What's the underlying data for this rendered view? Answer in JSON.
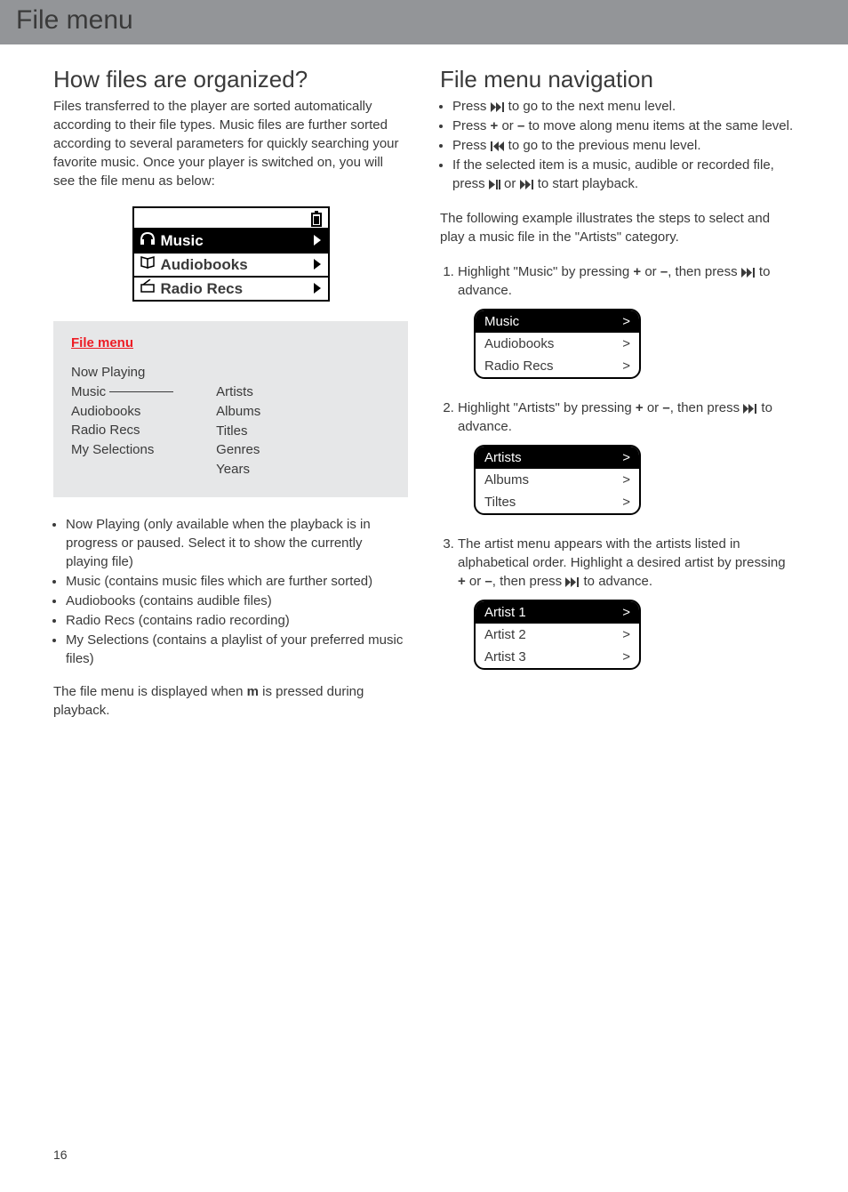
{
  "header": {
    "title": "File menu"
  },
  "page_number": "16",
  "left": {
    "heading": "How files are organized?",
    "intro": "Files transferred to the player are sorted automatically according to their file types. Music files are further sorted according to several parameters for quickly searching your favorite music. Once your player is switched on, you will see the file menu as below:",
    "device_menu": {
      "rows": [
        "Music",
        "Audiobooks",
        "Radio Recs"
      ]
    },
    "info_box": {
      "title": "File menu",
      "col1": [
        "Now Playing",
        "Music",
        "Audiobooks",
        "Radio Recs",
        "My Selections"
      ],
      "col2": [
        "Artists",
        "Albums",
        "Titles",
        "Genres",
        "Years"
      ]
    },
    "bullets": [
      "Now Playing (only available when the playback is in progress or paused. Select it to show the currently playing file)",
      "Music (contains music files which are further sorted)",
      "Audiobooks (contains audible files)",
      "Radio Recs (contains radio recording)",
      "My Selections (contains a playlist of your preferred music files)"
    ],
    "footer_pre": "The file menu is displayed when ",
    "footer_bold": "m",
    "footer_post": " is pressed during playback."
  },
  "right": {
    "heading": "File menu navigation",
    "nav_bullets": {
      "b1_pre": "Press ",
      "b1_post": " to go to the next menu level.",
      "b2_pre": "Press ",
      "b2_plus": "+",
      "b2_mid": " or ",
      "b2_minus": "–",
      "b2_post": " to move along menu items at the same level.",
      "b3_pre": "Press ",
      "b3_post": " to go to the previous menu level.",
      "b4_pre": "If the selected item is a music, audible or recorded file, press ",
      "b4_mid": " or ",
      "b4_post": " to start playback."
    },
    "example_intro": "The following example illustrates the steps to select and play a music file in the \"Artists\" category.",
    "steps": {
      "s1_pre": "Highlight \"Music\" by pressing ",
      "s1_plus": "+",
      "s1_mid": " or ",
      "s1_minus": "–",
      "s1_then": ", then press ",
      "s1_post": " to advance.",
      "screen1": {
        "rows": [
          {
            "label": "Music",
            "arrow": ">",
            "sel": true
          },
          {
            "label": "Audiobooks",
            "arrow": ">",
            "sel": false
          },
          {
            "label": "Radio Recs",
            "arrow": ">",
            "sel": false
          }
        ]
      },
      "s2_pre": "Highlight \"Artists\" by pressing ",
      "s2_plus": "+",
      "s2_mid": " or ",
      "s2_minus": "–",
      "s2_then": ", then press ",
      "s2_post": " to advance.",
      "screen2": {
        "rows": [
          {
            "label": "Artists",
            "arrow": ">",
            "sel": true
          },
          {
            "label": "Albums",
            "arrow": ">",
            "sel": false
          },
          {
            "label": "Tiltes",
            "arrow": ">",
            "sel": false
          }
        ]
      },
      "s3_pre": "The artist menu appears with the artists listed in alphabetical order. Highlight a desired artist by pressing ",
      "s3_plus": "+",
      "s3_mid": " or ",
      "s3_minus": "–",
      "s3_then": ", then press ",
      "s3_post": " to advance.",
      "screen3": {
        "rows": [
          {
            "label": "Artist 1",
            "arrow": ">",
            "sel": true
          },
          {
            "label": "Artist 2",
            "arrow": ">",
            "sel": false
          },
          {
            "label": "Artist 3",
            "arrow": ">",
            "sel": false
          }
        ]
      }
    }
  }
}
